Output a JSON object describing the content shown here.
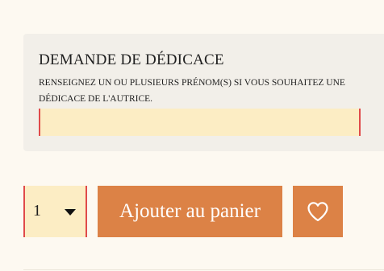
{
  "dedicace": {
    "title": "DEMANDE DE DÉDICACE",
    "help": "RENSEIGNEZ UN OU PLUSIEURS PRÉNOM(S) SI VOUS SOUHAITEZ UNE DÉDICACE DE L'AUTRICE.",
    "input_value": "",
    "input_placeholder": ""
  },
  "purchase": {
    "quantity": "1",
    "add_to_cart_label": "Ajouter au panier",
    "wishlist_icon": "heart-icon"
  },
  "colors": {
    "accent": "#dc8246",
    "field_bg": "#fcedc4",
    "field_border": "#e04a4a",
    "box_bg": "#f2efe9",
    "page_bg": "#fdf9f1"
  }
}
